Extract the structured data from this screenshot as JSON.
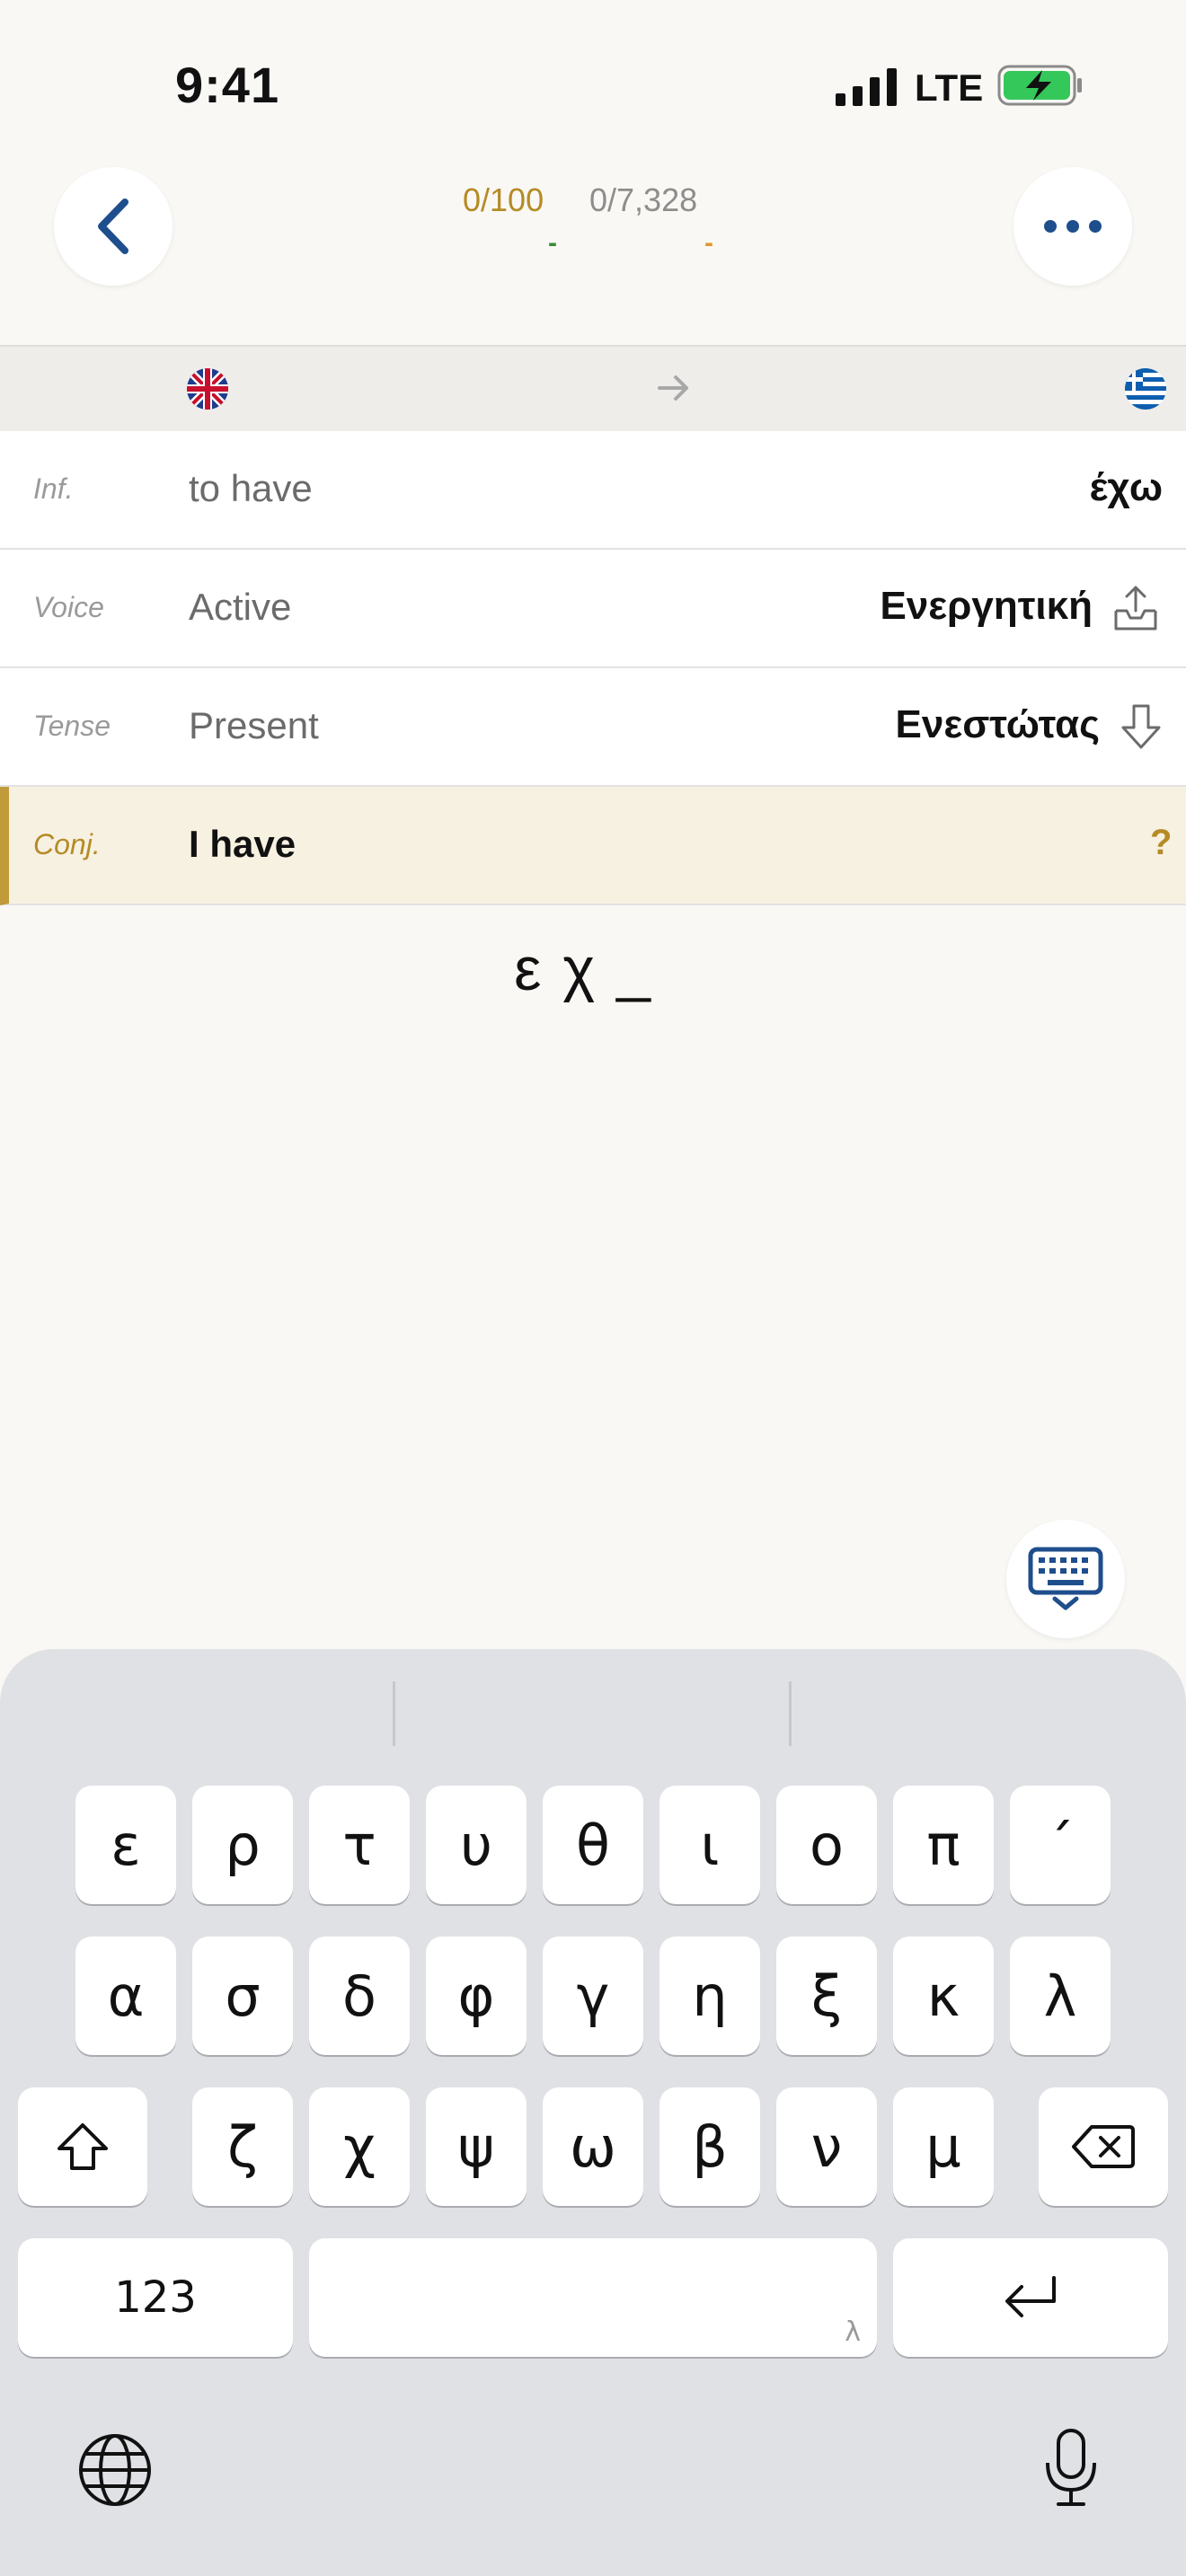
{
  "status_bar": {
    "time": "9:41",
    "network": "LTE"
  },
  "header": {
    "count_primary": "0/100",
    "count_secondary": "0/7,328",
    "dash_primary": "-",
    "dash_secondary": "-"
  },
  "language_bar": {
    "source_flag": "uk-flag",
    "target_flag": "greek-flag"
  },
  "rows": [
    {
      "label": "Inf.",
      "english": "to have",
      "greek": "έχω"
    },
    {
      "label": "Voice",
      "english": "Active",
      "greek": "Ενεργητική",
      "icon": "upload-tray-icon"
    },
    {
      "label": "Tense",
      "english": "Present",
      "greek": "Ενεστώτας",
      "icon": "arrow-down-icon"
    }
  ],
  "conjugation": {
    "label": "Conj.",
    "english": "I have",
    "hint": "?"
  },
  "answer": {
    "text": "εχ_"
  },
  "keyboard": {
    "row1": [
      "ε",
      "ρ",
      "τ",
      "υ",
      "θ",
      "ι",
      "ο",
      "π",
      "΄"
    ],
    "row2": [
      "α",
      "σ",
      "δ",
      "φ",
      "γ",
      "η",
      "ξ",
      "κ",
      "λ"
    ],
    "row3": [
      "ζ",
      "χ",
      "ψ",
      "ω",
      "β",
      "ν",
      "μ"
    ],
    "numbers_label": "123",
    "space_hint": "λ"
  },
  "colors": {
    "accent": "#b58b25",
    "brand_blue": "#1f4e8c",
    "conj_bg": "#f7f1e2"
  }
}
